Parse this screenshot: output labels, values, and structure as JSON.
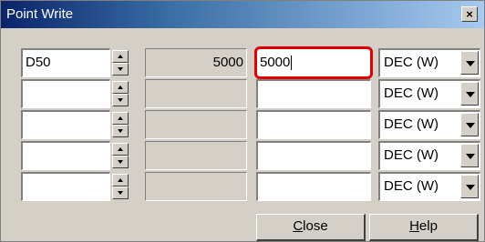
{
  "window": {
    "title": "Point Write",
    "close_glyph": "×"
  },
  "rows": [
    {
      "device": "D50",
      "current": "5000",
      "new_value": "5000",
      "format": "DEC (W)"
    },
    {
      "device": "",
      "current": "",
      "new_value": "",
      "format": "DEC (W)"
    },
    {
      "device": "",
      "current": "",
      "new_value": "",
      "format": "DEC (W)"
    },
    {
      "device": "",
      "current": "",
      "new_value": "",
      "format": "DEC (W)"
    },
    {
      "device": "",
      "current": "",
      "new_value": "",
      "format": "DEC (W)"
    }
  ],
  "buttons": {
    "close": {
      "mnemonic": "C",
      "rest": "lose"
    },
    "help": {
      "mnemonic": "H",
      "rest": "elp"
    }
  }
}
